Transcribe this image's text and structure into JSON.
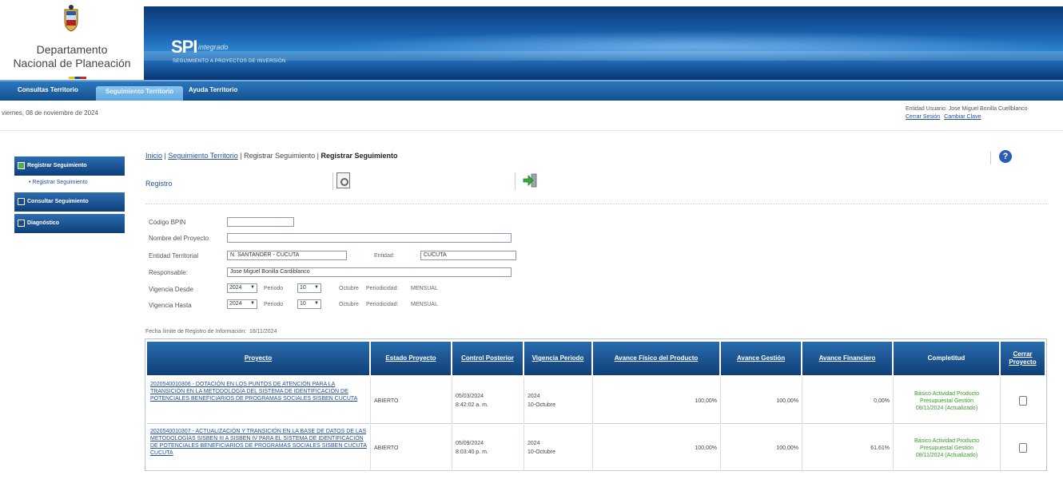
{
  "header": {
    "org_line1": "Departamento",
    "org_line2": "Nacional de Planeación",
    "app_name": "SPI",
    "app_sub": "integrado",
    "app_desc": "SEGUIMIENTO A PROYECTOS DE INVERSIÓN"
  },
  "nav": {
    "tabs": [
      {
        "label": "Consultas Territorio"
      },
      {
        "label": "Seguimiento Territorio"
      },
      {
        "label": "Ayuda Territorio"
      }
    ]
  },
  "date_line": "viernes, 08 de noviembre de 2024",
  "user": {
    "entity_label": "Entidad Usuario:",
    "name": "Jose Miguel Bonilla Cuellblanco",
    "logout": "Cerrar Sesión",
    "change_password": "Cambiar Clave"
  },
  "sidebar": {
    "items": [
      {
        "label": "Registrar Seguimiento"
      },
      {
        "label": "Consultar Seguimiento"
      },
      {
        "label": "Diagnóstico"
      }
    ],
    "sub_item": "Registrar Seguimiento"
  },
  "breadcrumb": {
    "home": "Inicio",
    "seg": "Seguimiento Territorio",
    "reg1": "Registrar Seguimiento",
    "current": "Registrar Seguimiento"
  },
  "section_title": "Registro",
  "form": {
    "codigo_label": "Código BPIN",
    "codigo_value": "",
    "nombre_label": "Nombre del Proyecto",
    "nombre_value": "",
    "entidad_label": "Entidad Territorial",
    "entidad_value": "N. SANTANDER - CUCUTA",
    "entidad2_label": "Entidad:",
    "entidad2_value": "CUCUTA",
    "responsable_label": "Responsable:",
    "responsable_value": "Jose Miguel Bonilla Cardiblanco",
    "desde_label": "Vigencia Desde",
    "desde_year": "2024",
    "desde_periodo_label": "Periodo",
    "desde_periodo": "10",
    "desde_mes": "Octubre",
    "desde_periodicidad_label": "Periodicidad:",
    "desde_periodicidad": "MENSUAL",
    "hasta_label": "Vigencia Hasta",
    "hasta_year": "2024",
    "hasta_periodo_label": "Periodo",
    "hasta_periodo": "10",
    "hasta_mes": "Octubre",
    "hasta_periodicidad_label": "Periodicidad:",
    "hasta_periodicidad": "MENSUAL"
  },
  "fecha_limite": {
    "label": "Fecha límite de Registro de Información:",
    "value": "18/11/2024"
  },
  "table": {
    "headers": [
      "Proyecto",
      "Estado Proyecto",
      "Control Posterior",
      "Vigencia Periodo",
      "Avance Físico del Producto",
      "Avance Gestión",
      "Avance Financiero",
      "Completitud",
      "Cerrar Proyecto"
    ],
    "rows": [
      {
        "proyecto": "2020540010306 - DOTACIÓN EN LOS PUNTOS DE ATENCIÓN PARA LA TRANSICIÓN EN LA METODOLOGÍA DEL SISTEMA DE IDENTIFICACIÓN DE POTENCIALES BENEFICIARIOS DE PROGRAMAS SOCIALES SISBEN CUCUTA",
        "estado": "ABIERTO",
        "control_fecha": "05/03/2024",
        "control_hora": "8:42:02 a. m.",
        "vig_anio": "2024",
        "vig_periodo": "10-Octubre",
        "fisico": "100,00%",
        "gestion": "100,00%",
        "financiero": "0,00%",
        "completitud_1": "Básico Actividad Producto",
        "completitud_2": "Presupuestal Gestión",
        "completitud_3": "08/11/2024 (Actualizado)"
      },
      {
        "proyecto": "2020540010307 - ACTUALIZACIÓN Y TRANSICIÓN EN LA BASE DE DATOS DE LAS METODOLOGÍAS SISBEN III A SISBEN IV PARA EL SISTEMA DE IDENTIFICACIÓN DE POTENCIALES BENEFICIARIOS DE PROGRAMAS SOCIALES SISBEN CUCUTA CUCUTA",
        "estado": "ABIERTO",
        "control_fecha": "05/09/2024",
        "control_hora": "8:03:40 p. m.",
        "vig_anio": "2024",
        "vig_periodo": "10-Octubre",
        "fisico": "100,00%",
        "gestion": "100,00%",
        "financiero": "61,61%",
        "completitud_1": "Básico Actividad Producto",
        "completitud_2": "Presupuestal Gestión",
        "completitud_3": "08/11/2024 (Actualizado)"
      }
    ]
  },
  "colors": {
    "header_blue": "#1a63b0",
    "nav_blue": "#11508f",
    "link_blue": "#1f4e9c",
    "completitud_green": "#3a9a2a"
  }
}
